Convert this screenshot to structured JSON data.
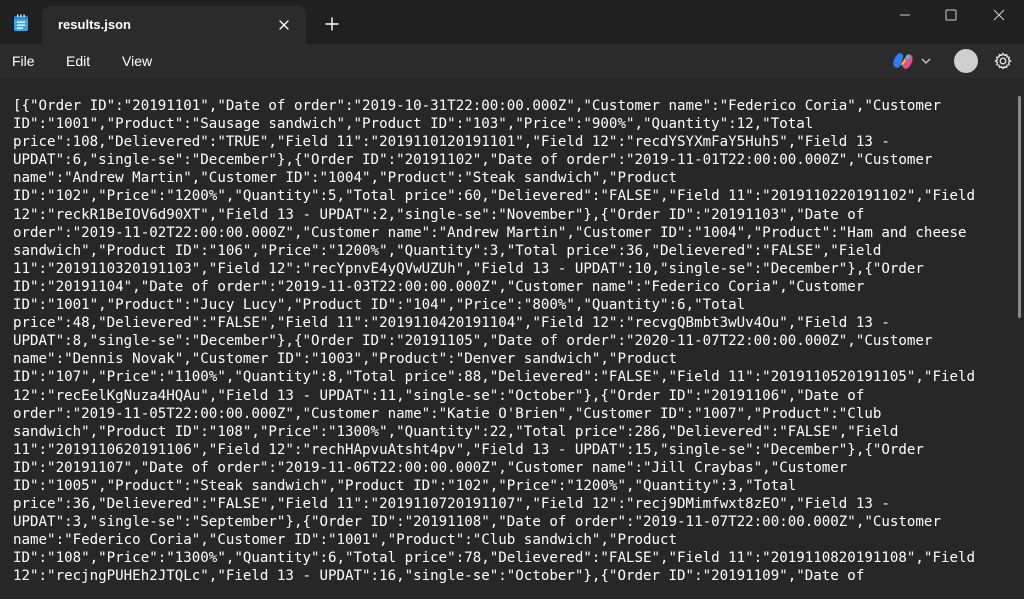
{
  "window": {
    "tab_title": "results.json",
    "icons": {
      "app": "notepad-icon",
      "tab_close": "close-icon",
      "new_tab": "plus-icon",
      "minimize": "minimize-icon",
      "maximize": "maximize-icon",
      "close": "close-icon"
    }
  },
  "menu": {
    "file": "File",
    "edit": "Edit",
    "view": "View",
    "right_icons": [
      "copilot-icon",
      "chevron-down-icon",
      "avatar",
      "gear-icon"
    ]
  },
  "colors": {
    "background": "#202020",
    "editor_background": "#272727",
    "text": "#ffffff"
  },
  "editor": {
    "lines": [
      "[{\"Order ID\":\"20191101\",\"Date of order\":\"2019-10-31T22:00:00.000Z\",\"Customer name\":\"Federico Coria\",\"Customer",
      "ID\":\"1001\",\"Product\":\"Sausage sandwich\",\"Product ID\":\"103\",\"Price\":\"900%\",\"Quantity\":12,\"Total",
      "price\":108,\"Delievered\":\"TRUE\",\"Field 11\":\"2019110120191101\",\"Field 12\":\"recdYSYXmFaY5Huh5\",\"Field 13 -",
      "UPDAT\":6,\"single-se\":\"December\"},{\"Order ID\":\"20191102\",\"Date of order\":\"2019-11-01T22:00:00.000Z\",\"Customer",
      "name\":\"Andrew Martin\",\"Customer ID\":\"1004\",\"Product\":\"Steak sandwich\",\"Product",
      "ID\":\"102\",\"Price\":\"1200%\",\"Quantity\":5,\"Total price\":60,\"Delievered\":\"FALSE\",\"Field 11\":\"2019110220191102\",\"Field",
      "12\":\"reckR1BeIOV6d90XT\",\"Field 13 - UPDAT\":2,\"single-se\":\"November\"},{\"Order ID\":\"20191103\",\"Date of",
      "order\":\"2019-11-02T22:00:00.000Z\",\"Customer name\":\"Andrew Martin\",\"Customer ID\":\"1004\",\"Product\":\"Ham and cheese",
      "sandwich\",\"Product ID\":\"106\",\"Price\":\"1200%\",\"Quantity\":3,\"Total price\":36,\"Delievered\":\"FALSE\",\"Field",
      "11\":\"2019110320191103\",\"Field 12\":\"recYpnvE4yQVwUZUh\",\"Field 13 - UPDAT\":10,\"single-se\":\"December\"},{\"Order",
      "ID\":\"20191104\",\"Date of order\":\"2019-11-03T22:00:00.000Z\",\"Customer name\":\"Federico Coria\",\"Customer",
      "ID\":\"1001\",\"Product\":\"Jucy Lucy\",\"Product ID\":\"104\",\"Price\":\"800%\",\"Quantity\":6,\"Total",
      "price\":48,\"Delievered\":\"FALSE\",\"Field 11\":\"2019110420191104\",\"Field 12\":\"recvgQBmbt3wUv4Ou\",\"Field 13 -",
      "UPDAT\":8,\"single-se\":\"December\"},{\"Order ID\":\"20191105\",\"Date of order\":\"2020-11-07T22:00:00.000Z\",\"Customer",
      "name\":\"Dennis Novak\",\"Customer ID\":\"1003\",\"Product\":\"Denver sandwich\",\"Product",
      "ID\":\"107\",\"Price\":\"1100%\",\"Quantity\":8,\"Total price\":88,\"Delievered\":\"FALSE\",\"Field 11\":\"2019110520191105\",\"Field",
      "12\":\"recEelKgNuza4HQAu\",\"Field 13 - UPDAT\":11,\"single-se\":\"October\"},{\"Order ID\":\"20191106\",\"Date of",
      "order\":\"2019-11-05T22:00:00.000Z\",\"Customer name\":\"Katie O'Brien\",\"Customer ID\":\"1007\",\"Product\":\"Club",
      "sandwich\",\"Product ID\":\"108\",\"Price\":\"1300%\",\"Quantity\":22,\"Total price\":286,\"Delievered\":\"FALSE\",\"Field",
      "11\":\"2019110620191106\",\"Field 12\":\"rechHApvuAtsht4pv\",\"Field 13 - UPDAT\":15,\"single-se\":\"December\"},{\"Order",
      "ID\":\"20191107\",\"Date of order\":\"2019-11-06T22:00:00.000Z\",\"Customer name\":\"Jill Craybas\",\"Customer",
      "ID\":\"1005\",\"Product\":\"Steak sandwich\",\"Product ID\":\"102\",\"Price\":\"1200%\",\"Quantity\":3,\"Total",
      "price\":36,\"Delievered\":\"FALSE\",\"Field 11\":\"2019110720191107\",\"Field 12\":\"recj9DMimfwxt8zEO\",\"Field 13 -",
      "UPDAT\":3,\"single-se\":\"September\"},{\"Order ID\":\"20191108\",\"Date of order\":\"2019-11-07T22:00:00.000Z\",\"Customer",
      "name\":\"Federico Coria\",\"Customer ID\":\"1001\",\"Product\":\"Club sandwich\",\"Product",
      "ID\":\"108\",\"Price\":\"1300%\",\"Quantity\":6,\"Total price\":78,\"Delievered\":\"FALSE\",\"Field 11\":\"2019110820191108\",\"Field",
      "12\":\"recjngPUHEh2JTQLc\",\"Field 13 - UPDAT\":16,\"single-se\":\"October\"},{\"Order ID\":\"20191109\",\"Date of"
    ]
  }
}
